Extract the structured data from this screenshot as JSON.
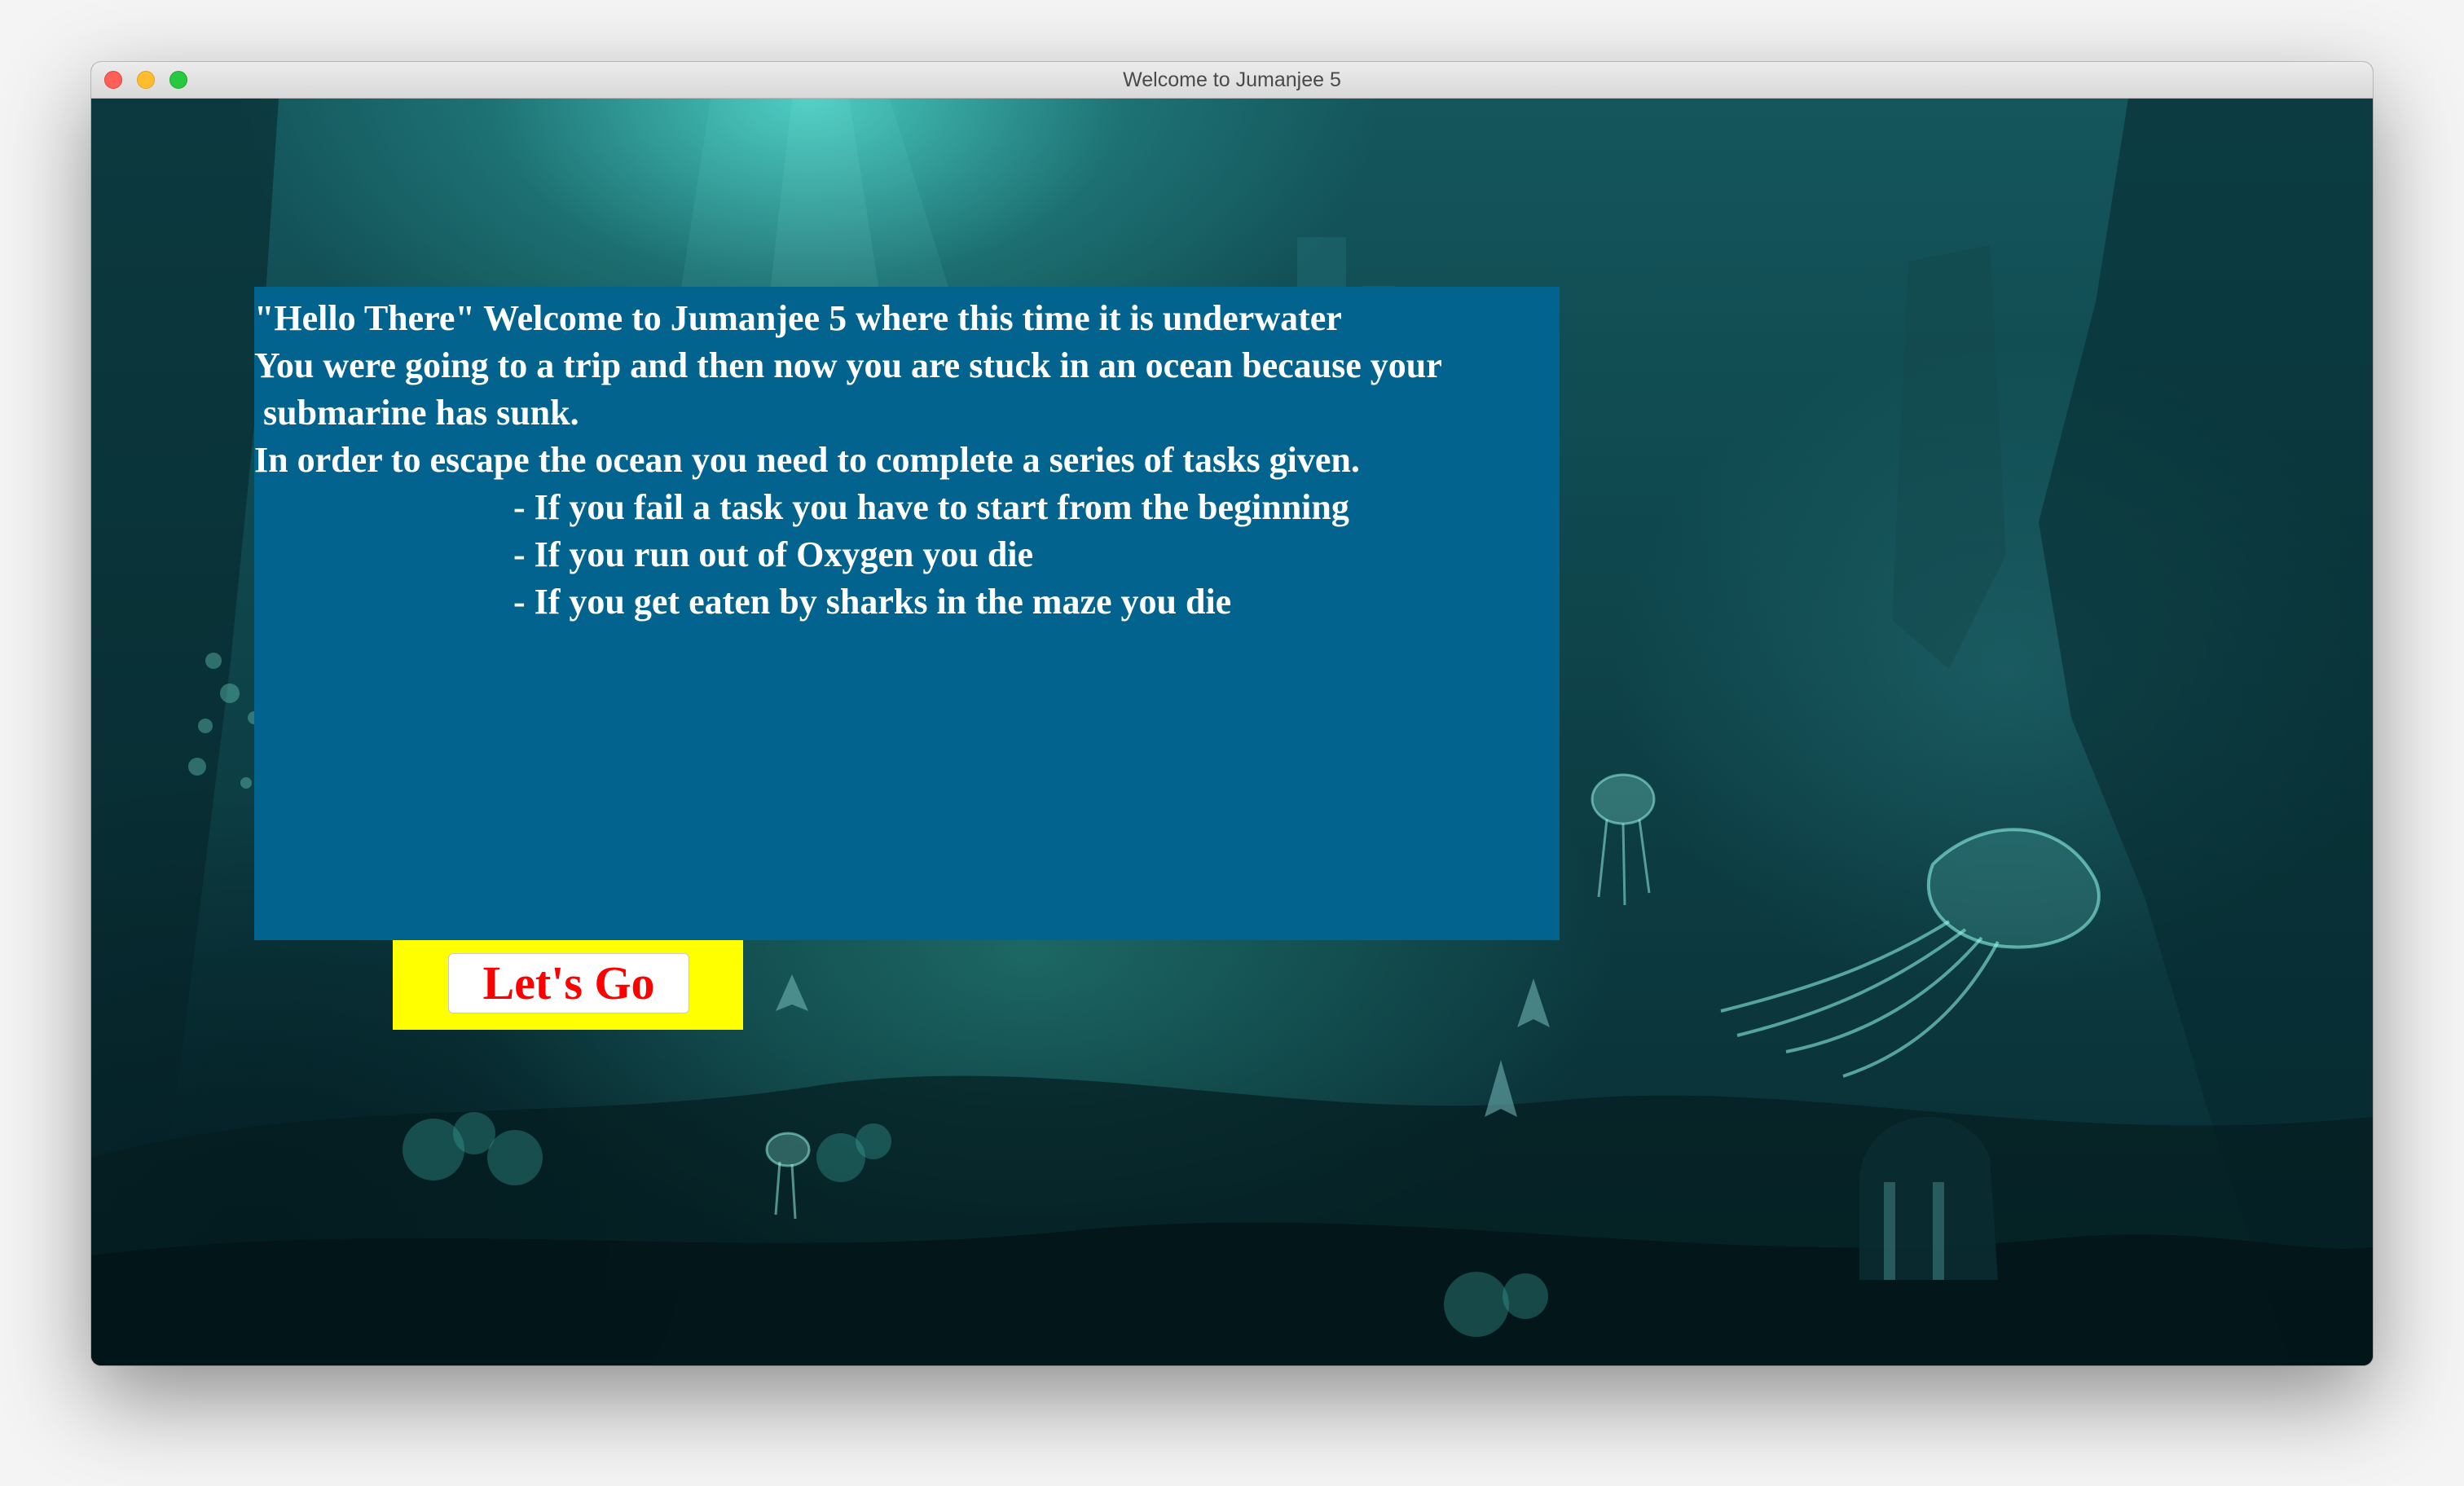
{
  "window": {
    "title": "Welcome to Jumanjee 5"
  },
  "background": {
    "description_icon": "underwater-scene-image"
  },
  "intro": {
    "lines": [
      "\"Hello There\" Welcome to Jumanjee 5 where this time it is underwater",
      "You were going to a trip and then now you are stuck in an ocean because your",
      " submarine has sunk.",
      "In order to escape the ocean you need to complete a series of tasks given.",
      "- If you fail a task you have to start from the beginning",
      "- If you run out of Oxygen you die",
      "- If you get eaten by sharks in the maze you die"
    ]
  },
  "actions": {
    "go_label": "Let's Go"
  },
  "colors": {
    "panel": "#03638f",
    "button_backdrop": "#ffff00",
    "button_text": "#ff0000",
    "text": "#ffffff"
  }
}
